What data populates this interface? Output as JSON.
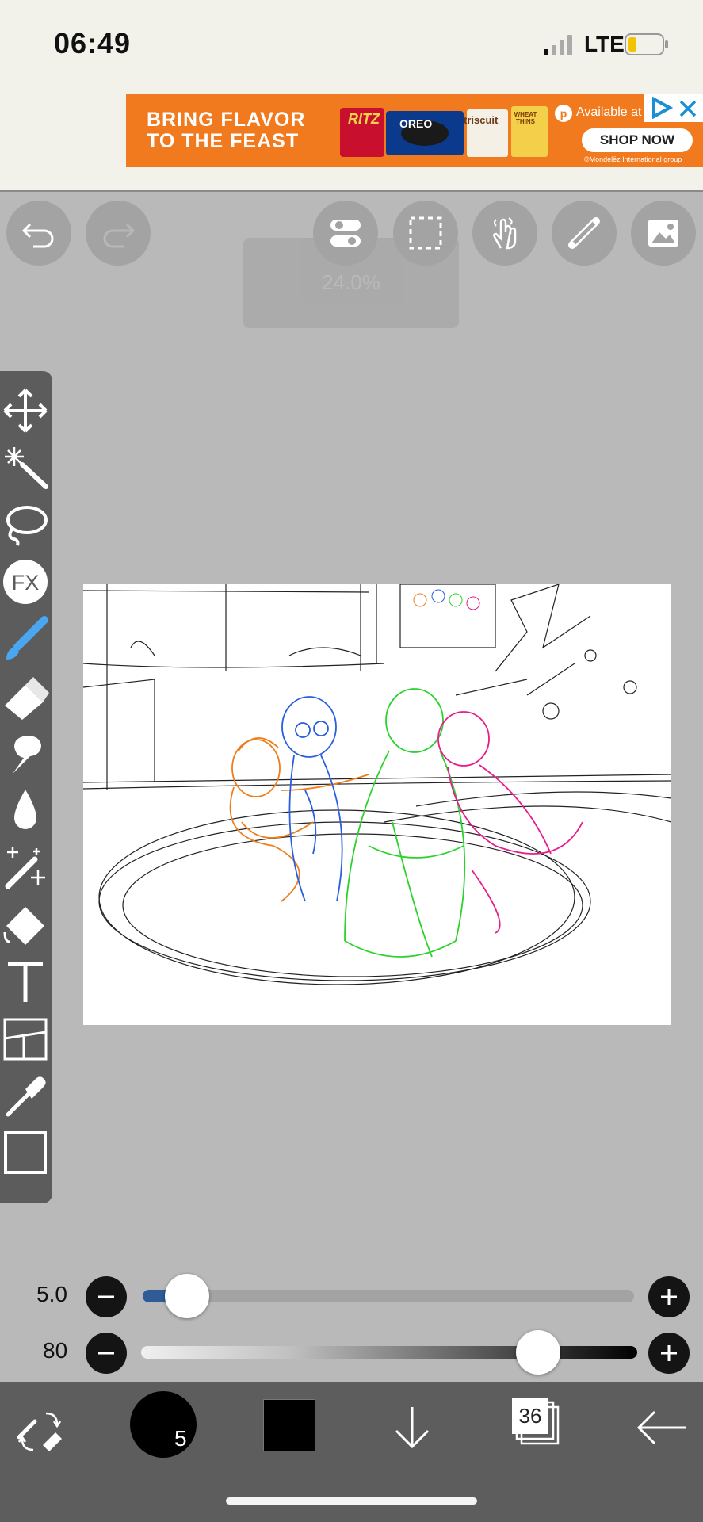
{
  "status": {
    "time": "06:49",
    "network": "LTE"
  },
  "ad": {
    "headline_1": "BRING FLAVOR",
    "headline_2": "TO THE FEAST",
    "available": "Available at",
    "cta": "SHOP NOW",
    "legal": "©Mondelēz International group",
    "brands": [
      "RITZ",
      "OREO",
      "triscuit",
      "WHEAT THINS"
    ]
  },
  "toolbar": {
    "zoom": "24.0%"
  },
  "tools": [
    "transform",
    "magic-wand",
    "lasso",
    "filter",
    "brush",
    "eraser",
    "smudge",
    "blur",
    "special-brush",
    "fill",
    "text",
    "frame-divider",
    "eyedropper",
    "canvas"
  ],
  "brush": {
    "size_label": "5.0",
    "size_fraction": 0.09,
    "opacity_label": "80",
    "opacity_fraction": 0.8
  },
  "bottombar": {
    "brush_size_badge": "5",
    "layers_count": "36"
  },
  "colors": {
    "accent": "#2f5c96",
    "panel": "#5c5c5c",
    "background": "#b9b9b9"
  }
}
